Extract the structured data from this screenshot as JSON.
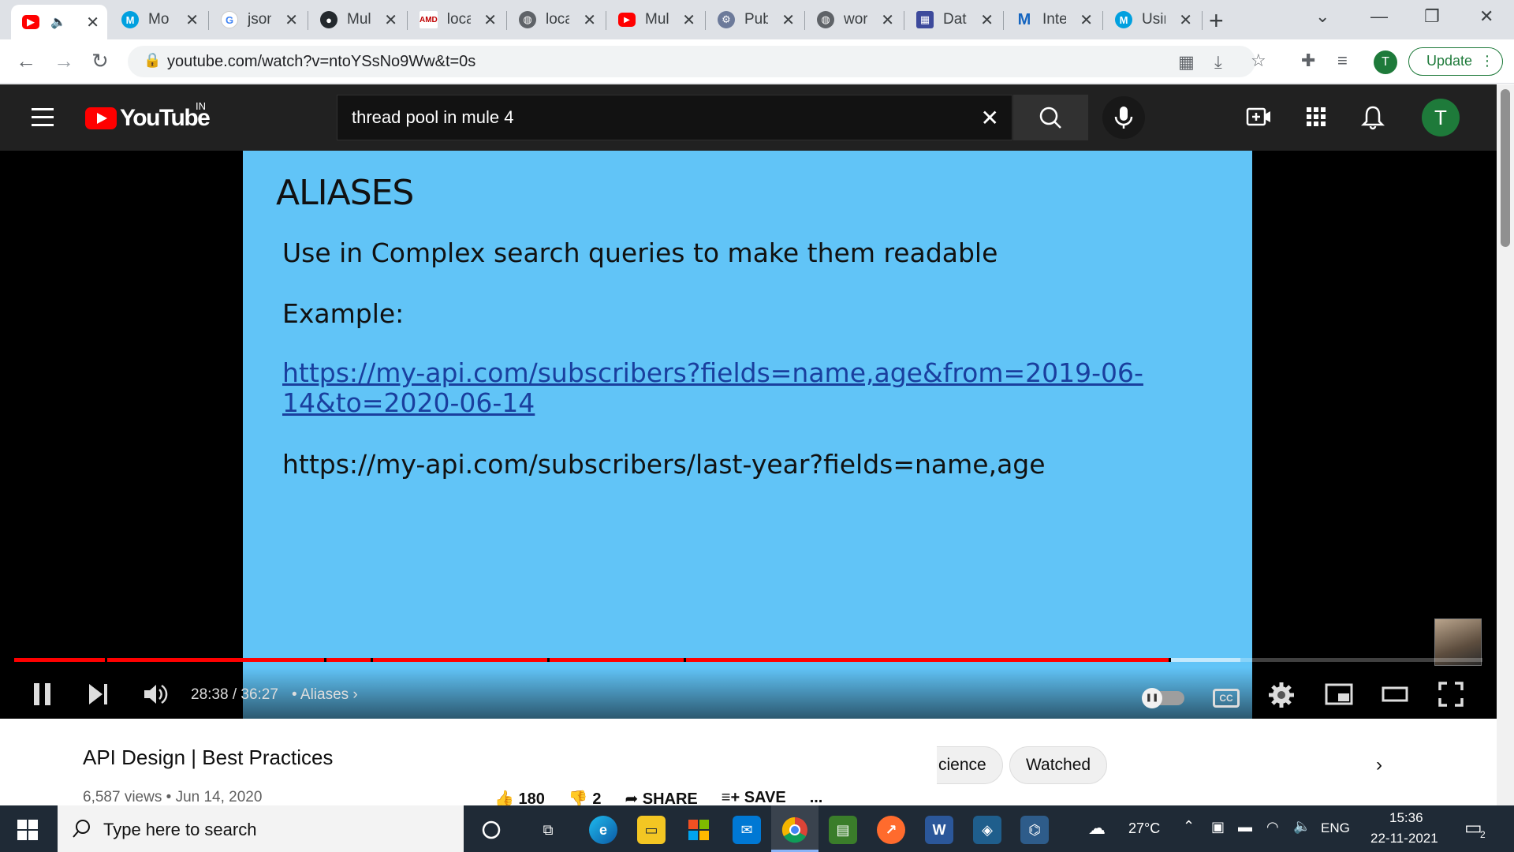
{
  "browser": {
    "tabs": [
      {
        "label": "",
        "favicon": "youtube-icon",
        "color": "#ff0000",
        "active": true,
        "audio": true
      },
      {
        "label": "Mo",
        "favicon": "mulesoft-icon",
        "color": "#00a0df"
      },
      {
        "label": "json",
        "favicon": "google-icon",
        "color": "#4285f4"
      },
      {
        "label": "Mul",
        "favicon": "github-icon",
        "color": "#24292e"
      },
      {
        "label": "loca",
        "favicon": "amd-icon",
        "color": "#c00000"
      },
      {
        "label": "loca",
        "favicon": "globe-icon",
        "color": "#5f6368"
      },
      {
        "label": "Mul",
        "favicon": "youtube-icon",
        "color": "#ff0000"
      },
      {
        "label": "Pub",
        "favicon": "gear-icon",
        "color": "#6c7a9a"
      },
      {
        "label": "wor",
        "favicon": "globe-icon",
        "color": "#5f6368"
      },
      {
        "label": "Dat",
        "favicon": "app-icon",
        "color": "#3d4a9c"
      },
      {
        "label": "Inte",
        "favicon": "mulesoft-m-icon",
        "color": "#1565c0"
      },
      {
        "label": "Usin",
        "favicon": "mulesoft-icon",
        "color": "#00a0df"
      }
    ],
    "url": "youtube.com/watch?v=ntoYSsNo9Ww&t=0s",
    "profile_initial": "T",
    "update_label": "Update"
  },
  "youtube": {
    "region": "IN",
    "logo_text": "YouTube",
    "search_query": "thread pool in mule 4",
    "avatar_initial": "T"
  },
  "slide": {
    "title": "ALIASES",
    "line1": "Use in Complex search queries to make them readable",
    "line2": "Example:",
    "link_part1": "https://my-api.com/subscribers?fields=name,age&from=2019-06-",
    "link_part2": "14&to=2020-06-14",
    "line4": "https://my-api.com/subscribers/last-year?fields=name,age"
  },
  "player": {
    "current_time": "28:38",
    "duration": "36:27",
    "time_separator": " / ",
    "chapter": "Aliases",
    "played_fraction": 0.786,
    "loaded_fraction": 0.835,
    "chapter_marks": [
      0.062,
      0.211,
      0.243,
      0.363,
      0.456,
      0.786
    ]
  },
  "video": {
    "title": "API Design | Best Practices",
    "views": "6,587 views",
    "date": "Jun 14, 2020",
    "likes": "180",
    "dislikes": "2",
    "share_label": "SHARE",
    "save_label": "SAVE",
    "more_label": "..."
  },
  "chips": [
    {
      "label": "cience"
    },
    {
      "label": "Watched"
    }
  ],
  "taskbar": {
    "search_placeholder": "Type here to search",
    "weather": "27°C",
    "language": "ENG",
    "time": "15:36",
    "date": "22-11-2021",
    "notification_count": "2"
  }
}
